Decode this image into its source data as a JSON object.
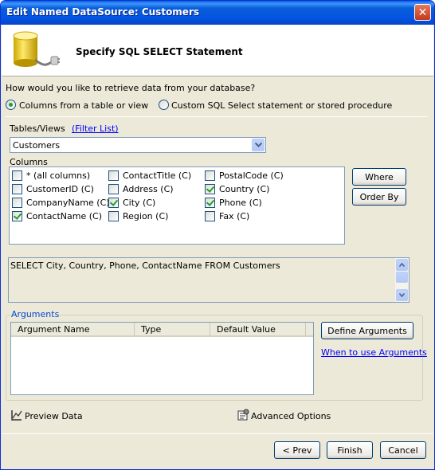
{
  "window": {
    "title": "Edit Named DataSource: Customers",
    "close_glyph": "✕"
  },
  "header": {
    "title": "Specify SQL SELECT Statement",
    "icon": "database-icon"
  },
  "retrieve": {
    "question": "How would you like to retrieve data from your database?",
    "option_table": "Columns from a table or view",
    "option_custom": "Custom SQL Select statement or stored procedure",
    "selected": "table"
  },
  "tables": {
    "label": "Tables/Views",
    "filter_link": "(Filter List)",
    "selected": "Customers"
  },
  "columns": {
    "label": "Columns",
    "items": [
      {
        "label": "* (all columns)",
        "checked": false
      },
      {
        "label": "CustomerID (C)",
        "checked": false
      },
      {
        "label": "CompanyName (C)",
        "checked": false
      },
      {
        "label": "ContactName (C)",
        "checked": true
      },
      {
        "label": "ContactTitle (C)",
        "checked": false
      },
      {
        "label": "Address (C)",
        "checked": false
      },
      {
        "label": "City (C)",
        "checked": true
      },
      {
        "label": "Region (C)",
        "checked": false
      },
      {
        "label": "PostalCode (C)",
        "checked": false
      },
      {
        "label": "Country (C)",
        "checked": true
      },
      {
        "label": "Phone (C)",
        "checked": true
      },
      {
        "label": "Fax (C)",
        "checked": false
      }
    ],
    "where_button": "Where",
    "orderby_button": "Order By"
  },
  "sql": {
    "text": "SELECT City, Country, Phone, ContactName FROM Customers"
  },
  "arguments": {
    "legend": "Arguments",
    "columns": [
      "Argument Name",
      "Type",
      "Default Value"
    ],
    "define_button": "Define Arguments",
    "help_link": "When to use Arguments"
  },
  "footer": {
    "preview": "Preview Data",
    "advanced": "Advanced Options",
    "prev_button": "< Prev",
    "finish_button": "Finish",
    "cancel_button": "Cancel"
  },
  "colors": {
    "accent": "#0a5fd8",
    "link": "#0000ff",
    "check": "#21a121",
    "face": "#ece9d8"
  }
}
